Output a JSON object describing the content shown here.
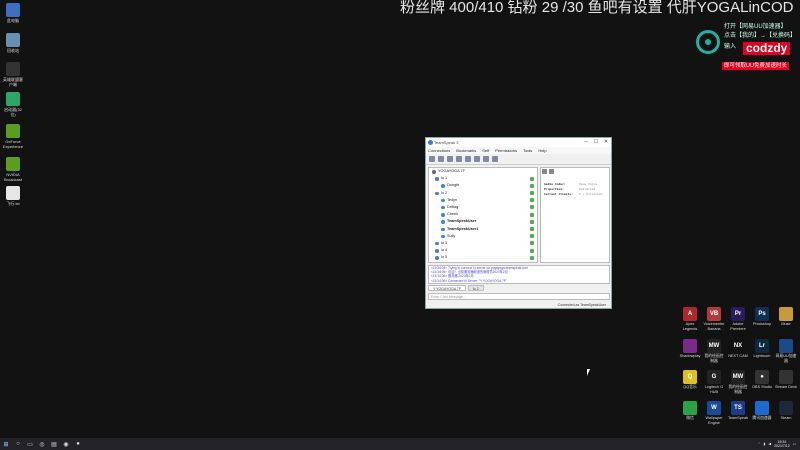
{
  "overlay": {
    "title": "粉丝牌 400/410 钻粉 29 /30 鱼吧有设置 代肝YOGALinCOD",
    "promo_line1": "打开【网易UU加速器】",
    "promo_line2": "点击【我的】→【兑换码】",
    "promo_line3": "输入",
    "promo_code": "codzdy",
    "promo_badge": "即可领取UU免费加速时长"
  },
  "desktop_left": [
    {
      "label": "此电脑",
      "icon": "computer-icon",
      "color": "#3a6fc2"
    },
    {
      "label": "回收站",
      "icon": "recycle-bin-icon",
      "color": "#6a8fb0"
    },
    {
      "label": "英雄联盟客户端",
      "icon": "league-icon",
      "color": "#333"
    },
    {
      "label": "启动器(32位)",
      "icon": "launcher-icon",
      "color": "#2da66a"
    },
    {
      "label": "GeForce Experience",
      "icon": "geforce-icon",
      "color": "#5a9e1c"
    },
    {
      "label": "NVIDIA Broadcast",
      "icon": "nvidia-broadcast-icon",
      "color": "#5a9e1c"
    },
    {
      "label": "飞行.txt",
      "icon": "text-file-icon",
      "color": "#e6e6e6"
    }
  ],
  "teamspeak": {
    "title": "TeamSpeak 3",
    "menu": [
      "Connections",
      "Bookmarks",
      "Self",
      "Permissions",
      "Tools",
      "Help"
    ],
    "server": "YOGAYOGA 7F",
    "channels": [
      {
        "name": "lo 1",
        "indent": 1
      },
      {
        "name": "Dongfé",
        "indent": 2
      },
      {
        "name": "lo 2",
        "indent": 1
      },
      {
        "name": "Tedyn",
        "indent": 2
      },
      {
        "name": "Driftag",
        "indent": 2
      },
      {
        "name": "Cheek",
        "indent": 2
      },
      {
        "name": "TeamSpeakUser",
        "indent": 2
      },
      {
        "name": "TeamSpeakUser1",
        "indent": 2
      },
      {
        "name": "Sully",
        "indent": 2
      },
      {
        "name": "lo 3",
        "indent": 1
      },
      {
        "name": "lo 4",
        "indent": 1
      },
      {
        "name": "lo 5",
        "indent": 1
      }
    ],
    "info": [
      {
        "key": "Audio Codec:",
        "value": "Opus Voice"
      },
      {
        "key": "Properties:",
        "value": "Unlimited"
      },
      {
        "key": "Current Clients:",
        "value": "5 / Unlimited"
      }
    ],
    "log": [
      "<15:34:04> Trying to connect to server on yogayoga.teamspeak.com",
      "<15:34:05> 欢迎！当前服务器频道的管理员2020年2月",
      "<15:34:06> 服务器 2020年2月",
      "<15:34:06> Connected to Server: \"Y YOGAYOGA 7F\"",
      "<15:34:06> You entered \"lo 2\" channel"
    ],
    "tabs": [
      "Y YOGAYOGA 7F",
      "lo 2"
    ],
    "chat_placeholder": "Enter Chat Message...",
    "status": "Connected as TeamSpeakUser"
  },
  "desktop_right": [
    {
      "label": "Apex Legends",
      "abbr": "A",
      "color": "#b0272e",
      "icon": "apex-icon"
    },
    {
      "label": "Voicemeeter Banana",
      "abbr": "VB",
      "color": "#b23a3a",
      "icon": "voicemeeter-icon"
    },
    {
      "label": "Adobe Premiere",
      "abbr": "Pr",
      "color": "#2a1a5e",
      "icon": "premiere-icon"
    },
    {
      "label": "Photoshop",
      "abbr": "Ps",
      "color": "#0f2f53",
      "icon": "photoshop-icon"
    },
    {
      "label": "Muse",
      "abbr": "",
      "color": "#c79a3a",
      "icon": "folder-icon"
    },
    {
      "label": "Shadowplay",
      "abbr": "",
      "color": "#7a2a8a",
      "icon": "shadowplay-icon"
    },
    {
      "label": "我的绘画控制器",
      "abbr": "MW",
      "color": "#222",
      "icon": "mw-icon"
    },
    {
      "label": "NEXT CAM",
      "abbr": "NX",
      "color": "#111",
      "icon": "nextcam-icon"
    },
    {
      "label": "Lightroom",
      "abbr": "Lr",
      "color": "#0b2a3e",
      "icon": "lightroom-icon"
    },
    {
      "label": "网易UU加速器",
      "abbr": "",
      "color": "#1a4a8a",
      "icon": "uu-icon"
    },
    {
      "label": "QQ音乐",
      "abbr": "Q",
      "color": "#e0c020",
      "icon": "qq-music-icon"
    },
    {
      "label": "Logitech G HUB",
      "abbr": "G",
      "color": "#222",
      "icon": "ghub-icon"
    },
    {
      "label": "我的绘画控制器",
      "abbr": "MW",
      "color": "#222",
      "icon": "mw2-icon"
    },
    {
      "label": "OBS Studio",
      "abbr": "●",
      "color": "#333",
      "icon": "obs-icon"
    },
    {
      "label": "Stream Deck",
      "abbr": "",
      "color": "#333",
      "icon": "streamdeck-icon"
    },
    {
      "label": "微信",
      "abbr": "",
      "color": "#2aa345",
      "icon": "wechat-icon"
    },
    {
      "label": "Wallpaper Engine",
      "abbr": "W",
      "color": "#1a4a9a",
      "icon": "wallpaper-engine-icon"
    },
    {
      "label": "TeamSpeak",
      "abbr": "TS",
      "color": "#1a3e8a",
      "icon": "teamspeak-icon"
    },
    {
      "label": "腾讯加速器",
      "abbr": "",
      "color": "#1a6ad0",
      "icon": "tencent-acc-icon"
    },
    {
      "label": "Steam",
      "abbr": "",
      "color": "#1b2838",
      "icon": "steam-icon"
    }
  ],
  "taskbar": {
    "time": "15:34",
    "date": "2021/7/12"
  }
}
